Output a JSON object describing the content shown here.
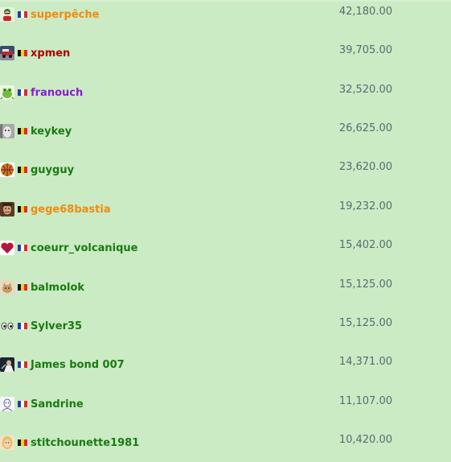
{
  "colors": {
    "background": "#cbebc4",
    "score_text": "#5a6a72"
  },
  "flags": {
    "fr": [
      "#1f3fa8",
      "#ffffff",
      "#e3262b"
    ],
    "be": [
      "#111111",
      "#f4d21a",
      "#e3262b"
    ]
  },
  "players": [
    {
      "name": "superpêche",
      "flag": "fr",
      "name_color": "#f08a10",
      "score": "42,180.00",
      "avatar": "character-avatar-icon"
    },
    {
      "name": "xpmen",
      "flag": "be",
      "name_color": "#b00000",
      "score": "39,705.00",
      "avatar": "car-photo-avatar-icon"
    },
    {
      "name": "franouch",
      "flag": "fr",
      "name_color": "#8a1cd8",
      "score": "32,520.00",
      "avatar": "frog-avatar-icon"
    },
    {
      "name": "keykey",
      "flag": "be",
      "name_color": "#1a7a12",
      "score": "26,625.00",
      "avatar": "animal-photo-avatar-icon"
    },
    {
      "name": "guyguy",
      "flag": "be",
      "name_color": "#1a7a12",
      "score": "23,620.00",
      "avatar": "basketball-avatar-icon"
    },
    {
      "name": "gege68bastia",
      "flag": "be",
      "name_color": "#f08a10",
      "score": "19,232.00",
      "avatar": "portrait-avatar-icon"
    },
    {
      "name": "coeurr_volcanique",
      "flag": "fr",
      "name_color": "#1a7a12",
      "score": "15,402.00",
      "avatar": "heart-avatar-icon"
    },
    {
      "name": "balmolok",
      "flag": "be",
      "name_color": "#1a7a12",
      "score": "15,125.00",
      "avatar": "cat-photo-avatar-icon"
    },
    {
      "name": "Sylver35",
      "flag": "fr",
      "name_color": "#1a7a12",
      "score": "15,125.00",
      "avatar": "eyes-avatar-icon"
    },
    {
      "name": "James bond 007",
      "flag": "fr",
      "name_color": "#1a7a12",
      "score": "14,371.00",
      "avatar": "photo-avatar-icon"
    },
    {
      "name": "Sandrine",
      "flag": "fr",
      "name_color": "#1a7a12",
      "score": "11,107.00",
      "avatar": "sketch-avatar-icon"
    },
    {
      "name": "stitchounette1981",
      "flag": "be",
      "name_color": "#1a7a12",
      "score": "10,420.00",
      "avatar": "blonde-avatar-icon"
    }
  ]
}
